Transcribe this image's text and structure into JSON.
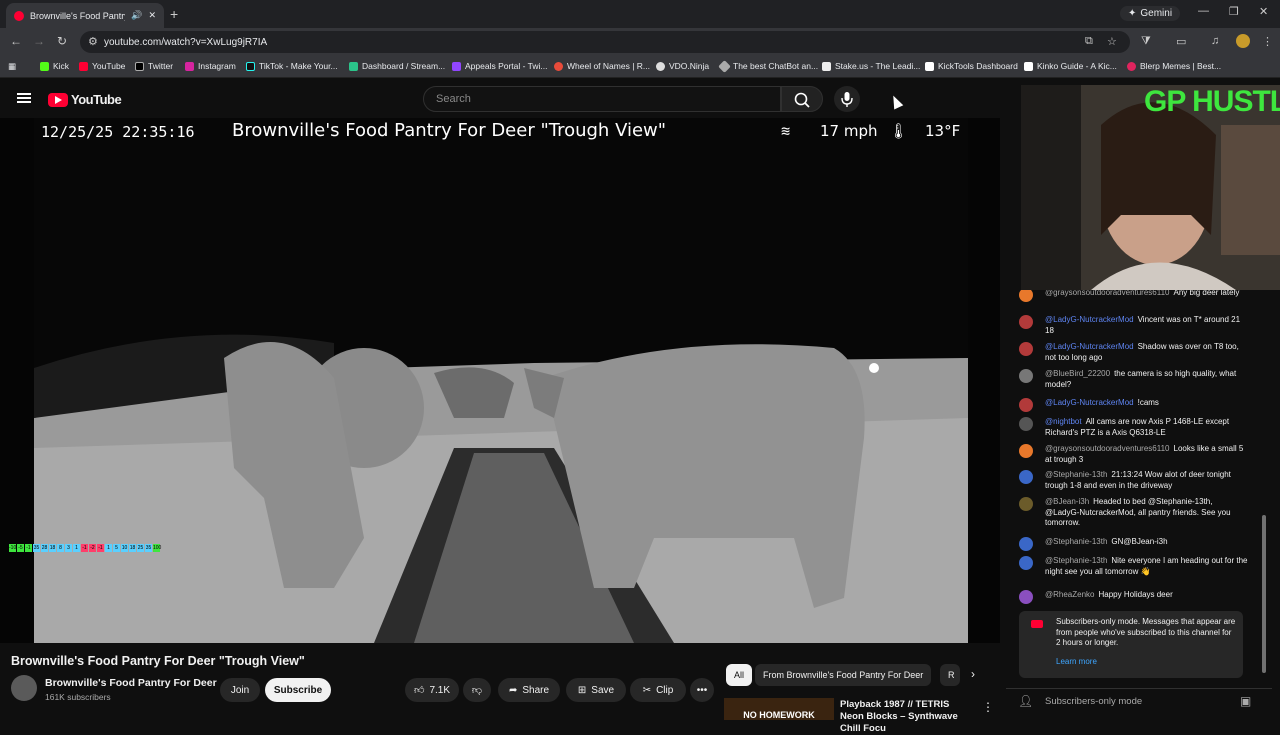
{
  "browser": {
    "tab_title": "Brownville's Food Pantry Fo",
    "new_tab": "+",
    "gemini_label": "Gemini",
    "url": "youtube.com/watch?v=XwLug9jR7IA",
    "bookmarks": [
      "Kick",
      "YouTube",
      "Twitter",
      "Instagram",
      "TikTok - Make Your...",
      "Dashboard / Stream...",
      "Appeals Portal - Twi...",
      "Wheel of Names | R...",
      "VDO.Ninja",
      "The best ChatBot an...",
      "Stake.us - The Leadi...",
      "KickTools Dashboard",
      "Kinko Guide - A Kic...",
      "Blerp Memes | Best..."
    ]
  },
  "youtube": {
    "logo": "YouTube",
    "search_placeholder": "Search"
  },
  "video": {
    "overlay_datetime": "12/25/25   22:35:16",
    "overlay_title": "Brownville's Food Pantry For Deer \"Trough View\"",
    "wind": "17 mph",
    "temp": "13°F",
    "meter_values": [
      "-10",
      "-5",
      "-1",
      "35",
      "28",
      "18",
      "8",
      "3",
      "1",
      "-1",
      "-2",
      "-1",
      "1",
      "5",
      "10",
      "18",
      "25",
      "35",
      "100"
    ]
  },
  "below": {
    "title": "Brownville's Food Pantry For Deer \"Trough View\"",
    "channel": "Brownville's Food Pantry For Deer",
    "subscribers": "161K subscribers",
    "join": "Join",
    "subscribe": "Subscribe",
    "likes": "7.1K",
    "share": "Share",
    "save": "Save",
    "clip": "Clip",
    "more": "•••"
  },
  "recs": {
    "chip_all": "All",
    "chip_channel": "From Brownville's Food Pantry For Deer",
    "chip_more": "R",
    "thumb_text": "NO HOMEWORK",
    "rec_title": "Playback 1987 // TETRIS Neon Blocks – Synthwave Chill Focu"
  },
  "chat": {
    "messages": [
      {
        "author": "@graysonsoutdooradventures6110",
        "text": "Any big deer lately",
        "color": "#e8782b",
        "mod": false
      },
      {
        "author": "@LadyG-NutcrackerMod",
        "text": "Vincent was on T* around 21 18",
        "color": "#b23a3a",
        "mod": true
      },
      {
        "author": "@LadyG-NutcrackerMod",
        "text": "Shadow was over on T8 too, not too long ago",
        "color": "#b23a3a",
        "mod": true
      },
      {
        "author": "@BlueBird_22200",
        "text": "the camera is so high quality, what model?",
        "color": "#777",
        "mod": false
      },
      {
        "author": "@LadyG-NutcrackerMod",
        "text": "!cams",
        "color": "#b23a3a",
        "mod": true
      },
      {
        "author": "@nightbot",
        "text": "All cams are now Axis P 1468-LE except Richard's PTZ is a Axis Q6318-LE",
        "color": "#555",
        "mod": true
      },
      {
        "author": "@graysonsoutdooradventures6110",
        "text": "Looks like a small 5 at trough 3",
        "color": "#e8782b",
        "mod": false
      },
      {
        "author": "@Stephanie-13th",
        "text": "21:13:24 Wow alot of deer tonight trough 1-8 and even in the driveway",
        "color": "#3a67c7",
        "mod": false
      },
      {
        "author": "@BJean-i3h",
        "text": "Headed to bed @Stephanie-13th, @LadyG-NutcrackerMod, all pantry friends. See you tomorrow.",
        "color": "#6b5b2a",
        "mod": false
      },
      {
        "author": "@Stephanie-13th",
        "text": "GN@BJean-i3h",
        "color": "#3a67c7",
        "mod": false
      },
      {
        "author": "@Stephanie-13th",
        "text": "Nite everyone I am heading out for the night see you all tomorrow 👋",
        "color": "#3a67c7",
        "mod": false
      },
      {
        "author": "@RheaZenko",
        "text": "Happy Holidays deer",
        "color": "#8a4fbf",
        "mod": false
      }
    ],
    "notice_text": "Subscribers-only mode. Messages that appear are from people who've subscribed to this channel for 2 hours or longer.",
    "notice_link": "Learn more",
    "footer": "Subscribers-only mode"
  },
  "webcam": {
    "overlay_text": "GP HUSTLA"
  }
}
